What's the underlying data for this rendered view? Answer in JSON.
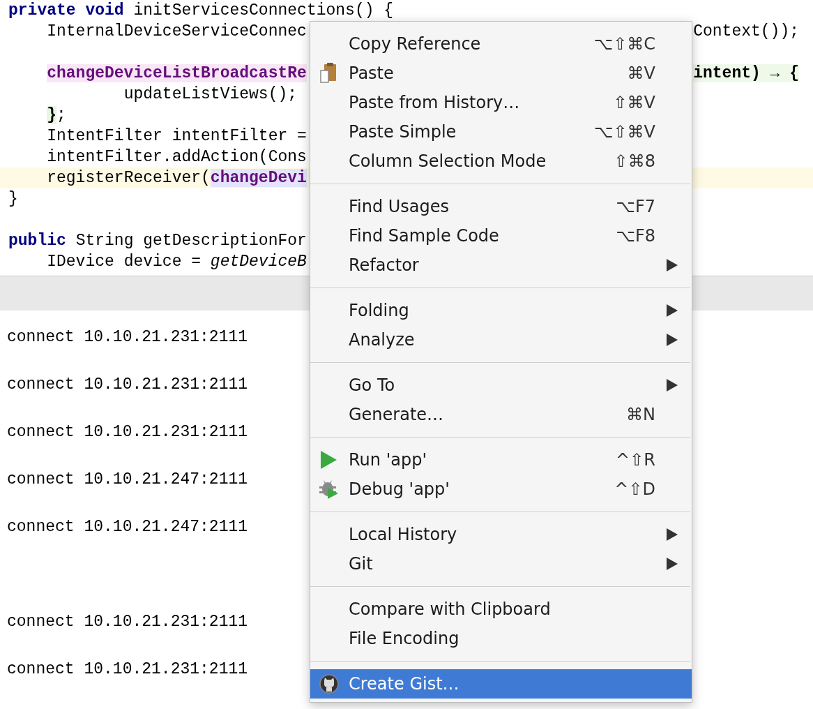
{
  "editor": {
    "lines": [
      {
        "current": false,
        "blank_before": false,
        "segments": [
          {
            "kind": "keyword",
            "text": "private void"
          },
          {
            "kind": "plain",
            "text": " initServicesConnections() {"
          }
        ]
      },
      {
        "current": false,
        "blank_before": false,
        "segments": [
          {
            "kind": "plain",
            "text": "    InternalDeviceServiceConnec"
          }
        ],
        "right": [
          {
            "kind": "plain",
            "text": "Context());"
          }
        ]
      },
      {
        "current": false,
        "blank_before": true,
        "indented": true,
        "segments": [
          {
            "kind": "lambda-field",
            "text": "changeDeviceListBroadcastRe"
          }
        ],
        "right": [
          {
            "kind": "lambda",
            "text": "intent) → {"
          }
        ]
      },
      {
        "current": false,
        "blank_before": false,
        "segments": [
          {
            "kind": "plain",
            "text": "            updateListViews();"
          }
        ]
      },
      {
        "current": false,
        "blank_before": false,
        "indented": true,
        "segments": [
          {
            "kind": "lambda-end",
            "text": "}"
          },
          {
            "kind": "plain",
            "text": ";"
          }
        ]
      },
      {
        "current": false,
        "blank_before": false,
        "segments": [
          {
            "kind": "plain",
            "text": "    IntentFilter intentFilter ="
          }
        ]
      },
      {
        "current": false,
        "blank_before": false,
        "segments": [
          {
            "kind": "plain",
            "text": "    intentFilter.addAction(Cons"
          }
        ]
      },
      {
        "current": true,
        "blank_before": false,
        "segments": [
          {
            "kind": "plain",
            "text": "    registerReceiver("
          },
          {
            "kind": "field-ref",
            "text": "changeDevi"
          }
        ]
      },
      {
        "current": false,
        "blank_before": false,
        "segments": [
          {
            "kind": "plain",
            "text": "}"
          }
        ]
      },
      {
        "current": false,
        "blank_before": true,
        "segments": [
          {
            "kind": "keyword",
            "text": "public"
          },
          {
            "kind": "plain",
            "text": " String getDescriptionFor"
          }
        ]
      },
      {
        "current": false,
        "blank_before": false,
        "segments": [
          {
            "kind": "plain",
            "text": "    IDevice device = "
          },
          {
            "kind": "italic",
            "text": "getDeviceB"
          }
        ]
      }
    ]
  },
  "console": {
    "lines": [
      {
        "text": "connect 10.10.21.231:2111",
        "blank_before": false
      },
      {
        "text": "connect 10.10.21.231:2111",
        "blank_before": false
      },
      {
        "text": "connect 10.10.21.231:2111",
        "blank_before": false
      },
      {
        "text": "connect 10.10.21.247:2111",
        "blank_before": false
      },
      {
        "text": "connect 10.10.21.247:2111",
        "blank_before": false
      },
      {
        "text": "connect 10.10.21.231:2111",
        "blank_before": true
      },
      {
        "text": "connect 10.10.21.231:2111",
        "blank_before": false
      }
    ]
  },
  "menu": {
    "groups": [
      {
        "items": [
          {
            "kind": "plain",
            "label": "Copy Reference",
            "shortcut": "⌥⇧⌘C",
            "submenu": false,
            "selected": false
          },
          {
            "kind": "paste",
            "label": "Paste",
            "shortcut": "⌘V",
            "submenu": false,
            "selected": false
          },
          {
            "kind": "plain",
            "label": "Paste from History…",
            "shortcut": "⇧⌘V",
            "submenu": false,
            "selected": false
          },
          {
            "kind": "plain",
            "label": "Paste Simple",
            "shortcut": "⌥⇧⌘V",
            "submenu": false,
            "selected": false
          },
          {
            "kind": "plain",
            "label": "Column Selection Mode",
            "shortcut": "⇧⌘8",
            "submenu": false,
            "selected": false
          }
        ]
      },
      {
        "items": [
          {
            "kind": "plain",
            "label": "Find Usages",
            "shortcut": "⌥F7",
            "submenu": false,
            "selected": false
          },
          {
            "kind": "plain",
            "label": "Find Sample Code",
            "shortcut": "⌥F8",
            "submenu": false,
            "selected": false
          },
          {
            "kind": "plain",
            "label": "Refactor",
            "submenu": true,
            "selected": false
          }
        ]
      },
      {
        "items": [
          {
            "kind": "plain",
            "label": "Folding",
            "submenu": true,
            "selected": false
          },
          {
            "kind": "plain",
            "label": "Analyze",
            "submenu": true,
            "selected": false
          }
        ]
      },
      {
        "items": [
          {
            "kind": "plain",
            "label": "Go To",
            "submenu": true,
            "selected": false
          },
          {
            "kind": "plain",
            "label": "Generate…",
            "shortcut": "⌘N",
            "submenu": false,
            "selected": false
          }
        ]
      },
      {
        "items": [
          {
            "kind": "run",
            "label": "Run 'app'",
            "shortcut": "^⇧R",
            "submenu": false,
            "selected": false
          },
          {
            "kind": "debug",
            "label": "Debug 'app'",
            "shortcut": "^⇧D",
            "submenu": false,
            "selected": false
          }
        ]
      },
      {
        "items": [
          {
            "kind": "plain",
            "label": "Local History",
            "submenu": true,
            "selected": false
          },
          {
            "kind": "plain",
            "label": "Git",
            "submenu": true,
            "selected": false
          }
        ]
      },
      {
        "items": [
          {
            "kind": "plain",
            "label": "Compare with Clipboard",
            "submenu": false,
            "selected": false
          },
          {
            "kind": "plain",
            "label": "File Encoding",
            "submenu": false,
            "selected": false
          }
        ]
      },
      {
        "items": [
          {
            "kind": "gist",
            "label": "Create Gist…",
            "submenu": false,
            "selected": true
          }
        ]
      }
    ]
  }
}
